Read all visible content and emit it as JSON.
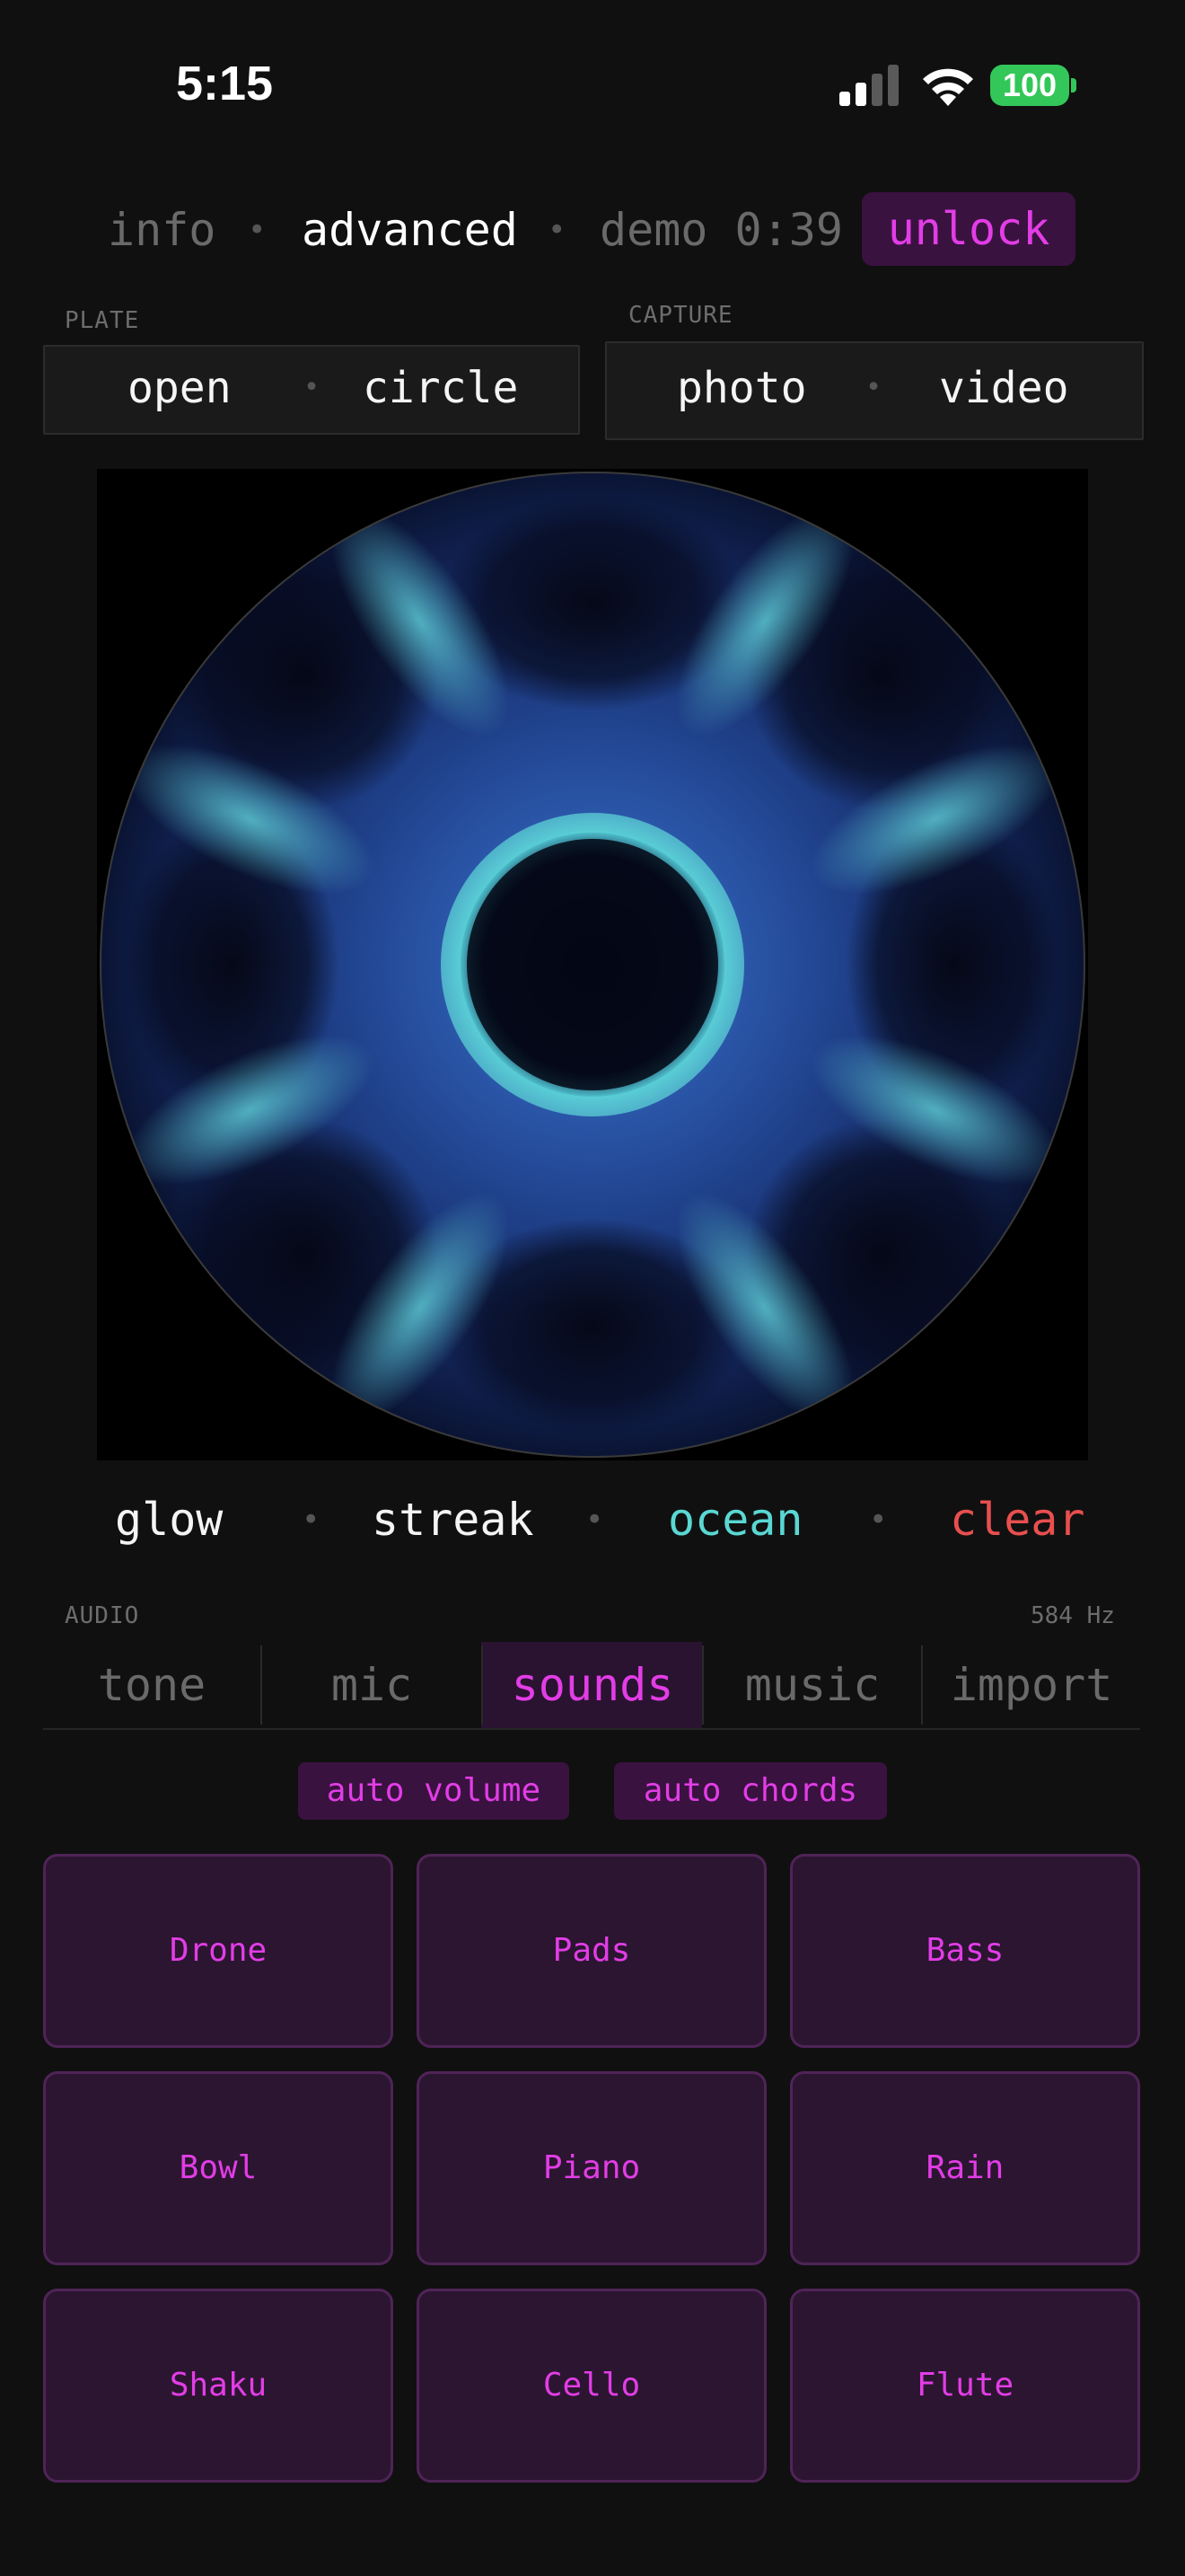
{
  "status": {
    "time": "5:15",
    "battery": "100"
  },
  "nav": {
    "info": "info",
    "advanced": "advanced",
    "demo": "demo 0:39",
    "unlock": "unlock"
  },
  "plate": {
    "label": "PLATE",
    "open": "open",
    "circle": "circle"
  },
  "capture": {
    "label": "CAPTURE",
    "photo": "photo",
    "video": "video"
  },
  "effects": {
    "glow": "glow",
    "streak": "streak",
    "ocean": "ocean",
    "clear": "clear"
  },
  "audio": {
    "label": "AUDIO",
    "frequency": "584 Hz",
    "tabs": [
      "tone",
      "mic",
      "sounds",
      "music",
      "import"
    ],
    "active_tab": "sounds",
    "toggles": {
      "auto_volume": "auto volume",
      "auto_chords": "auto chords"
    },
    "sounds": [
      "Drone",
      "Pads",
      "Bass",
      "Bowl",
      "Piano",
      "Rain",
      "Shaku",
      "Cello",
      "Flute"
    ]
  },
  "colors": {
    "accent": "#e23de6",
    "accent_bg": "#3a1240",
    "ocean": "#5ad7d3",
    "clear": "#e84f4f",
    "battery": "#33c759"
  },
  "icons": [
    "cellular-signal-icon",
    "wifi-icon",
    "battery-icon"
  ]
}
